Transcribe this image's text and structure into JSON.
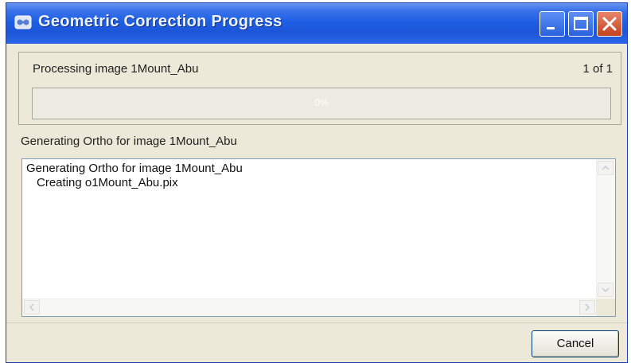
{
  "window": {
    "title": "Geometric Correction Progress",
    "controls": [
      "minimize",
      "maximize",
      "close"
    ],
    "icon": "app-icon"
  },
  "progress_group": {
    "processing_text": "Processing image 1Mount_Abu",
    "count_text": "1 of 1",
    "progress_label": "0%",
    "progress_fraction": 0
  },
  "status": {
    "label": "Generating Ortho for image 1Mount_Abu"
  },
  "log": {
    "lines": [
      "Generating Ortho for image 1Mount_Abu",
      "Creating o1Mount_Abu.pix"
    ]
  },
  "buttons": {
    "cancel_label": "Cancel"
  },
  "colors": {
    "titlebar": "#1e5fe3",
    "dialog_bg": "#ece9d8",
    "close_button": "#c4421d"
  }
}
